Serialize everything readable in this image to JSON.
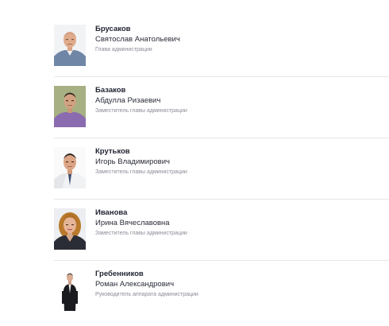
{
  "staff": [
    {
      "surname": "Брусаков",
      "given_names": "Святослав Анатольевич",
      "position": "Глава администрации",
      "photo_icon": "person-photo-bald-man-blue-shirt"
    },
    {
      "surname": "Базаков",
      "given_names": "Абдулла Ризаевич",
      "position": "Заместитель главы администрации",
      "photo_icon": "person-photo-man-purple-shirt"
    },
    {
      "surname": "Крутьков",
      "given_names": "Игорь Владимирович",
      "position": "Заместитель главы администрации",
      "photo_icon": "person-photo-man-white-shirt"
    },
    {
      "surname": "Иванова",
      "given_names": "Ирина Вячеславовна",
      "position": "Заместитель главы администрации",
      "photo_icon": "person-photo-woman-dark-jacket"
    },
    {
      "surname": "Гребенников",
      "given_names": "Роман Александрович",
      "position": "Руководитель аппарата администрации",
      "photo_icon": "person-photo-man-black-suit"
    }
  ]
}
